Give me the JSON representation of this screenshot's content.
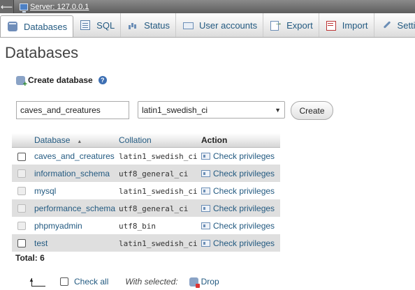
{
  "topbar": {
    "back_glyph": "⟵",
    "server_label": "Server: 127.0.0.1"
  },
  "tabs": [
    {
      "label": "Databases",
      "icon": "database-icon",
      "active": true
    },
    {
      "label": "SQL",
      "icon": "sql-icon"
    },
    {
      "label": "Status",
      "icon": "status-icon"
    },
    {
      "label": "User accounts",
      "icon": "user-accounts-icon"
    },
    {
      "label": "Export",
      "icon": "export-icon"
    },
    {
      "label": "Import",
      "icon": "import-icon"
    },
    {
      "label": "Setti",
      "icon": "settings-icon"
    }
  ],
  "page_title": "Databases",
  "create": {
    "label": "Create database",
    "help_glyph": "?",
    "name_value": "caves_and_creatures",
    "collation_value": "latin1_swedish_ci",
    "button_label": "Create"
  },
  "table": {
    "headers": {
      "database": "Database",
      "sort_glyph": "▲",
      "collation": "Collation",
      "action": "Action"
    },
    "rows": [
      {
        "name": "caves_and_creatures",
        "collation": "latin1_swedish_ci",
        "action": "Check privileges",
        "selectable": true
      },
      {
        "name": "information_schema",
        "collation": "utf8_general_ci",
        "action": "Check privileges",
        "selectable": false
      },
      {
        "name": "mysql",
        "collation": "latin1_swedish_ci",
        "action": "Check privileges",
        "selectable": false
      },
      {
        "name": "performance_schema",
        "collation": "utf8_general_ci",
        "action": "Check privileges",
        "selectable": false
      },
      {
        "name": "phpmyadmin",
        "collation": "utf8_bin",
        "action": "Check privileges",
        "selectable": false
      },
      {
        "name": "test",
        "collation": "latin1_swedish_ci",
        "action": "Check privileges",
        "selectable": true
      }
    ]
  },
  "total": "Total: 6",
  "footer": {
    "check_all": "Check all",
    "with_selected": "With selected:",
    "drop": "Drop"
  }
}
